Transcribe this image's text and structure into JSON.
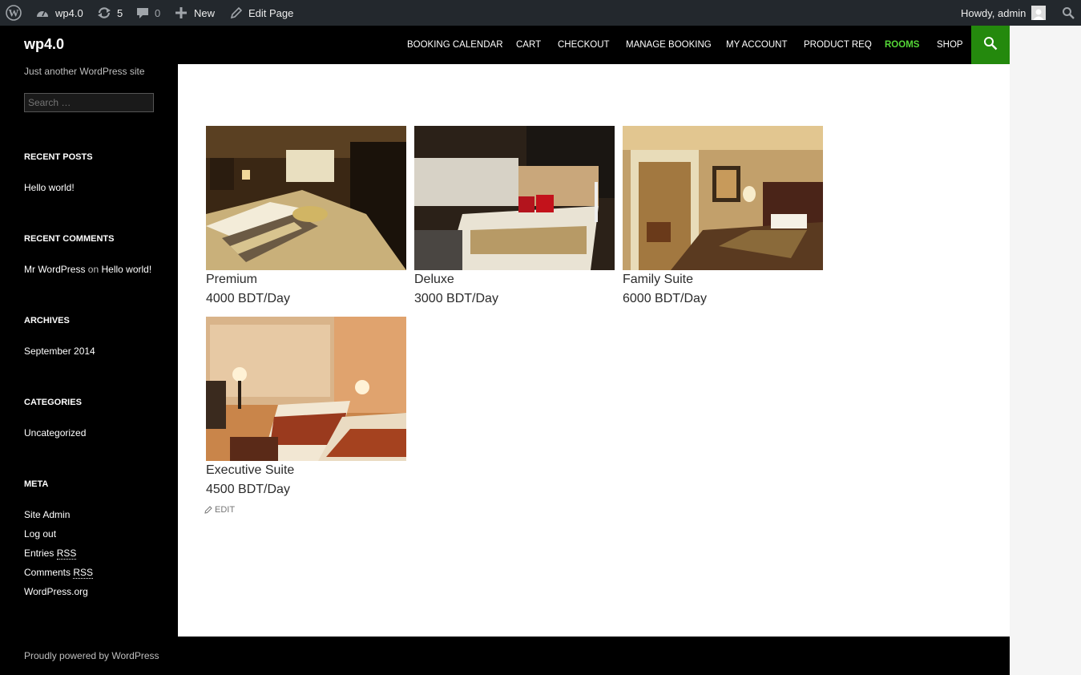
{
  "admin_bar": {
    "site_name": "wp4.0",
    "updates_count": "5",
    "comments_count": "0",
    "new_label": "New",
    "edit_label": "Edit Page",
    "greeting": "Howdy, admin"
  },
  "site": {
    "title": "wp4.0",
    "tagline": "Just another WordPress site",
    "search_placeholder": "Search …"
  },
  "nav": {
    "items": [
      {
        "label": "Booking Calendar"
      },
      {
        "label": "Cart"
      },
      {
        "label": "Checkout"
      },
      {
        "label": "Manage Booking"
      },
      {
        "label": "My Account"
      },
      {
        "label": "Product Req"
      },
      {
        "label": "Rooms"
      },
      {
        "label": "Shop"
      }
    ],
    "active": "Rooms"
  },
  "sidebar": {
    "recent_posts": {
      "title": "Recent Posts",
      "items": [
        "Hello world!"
      ]
    },
    "recent_comments": {
      "title": "Recent Comments",
      "author": "Mr WordPress",
      "on": "on",
      "post": "Hello world!"
    },
    "archives": {
      "title": "Archives",
      "items": [
        "September 2014"
      ]
    },
    "categories": {
      "title": "Categories",
      "items": [
        "Uncategorized"
      ]
    },
    "meta": {
      "title": "Meta",
      "items": [
        "Site Admin",
        "Log out"
      ],
      "entries": "Entries",
      "comments": "Comments",
      "rss": "RSS",
      "wordpress_org": "WordPress.org"
    }
  },
  "rooms": [
    {
      "name": "Premium",
      "price": "4000 BDT/Day"
    },
    {
      "name": "Deluxe",
      "price": "3000 BDT/Day"
    },
    {
      "name": "Family Suite",
      "price": "6000 BDT/Day"
    },
    {
      "name": "Executive Suite",
      "price": "4500 BDT/Day"
    }
  ],
  "edit_link": "Edit",
  "footer": {
    "credit": "Proudly powered by WordPress"
  },
  "colors": {
    "accent": "#24890d",
    "active_nav": "#55d737",
    "admin_bar": "#23282d"
  }
}
